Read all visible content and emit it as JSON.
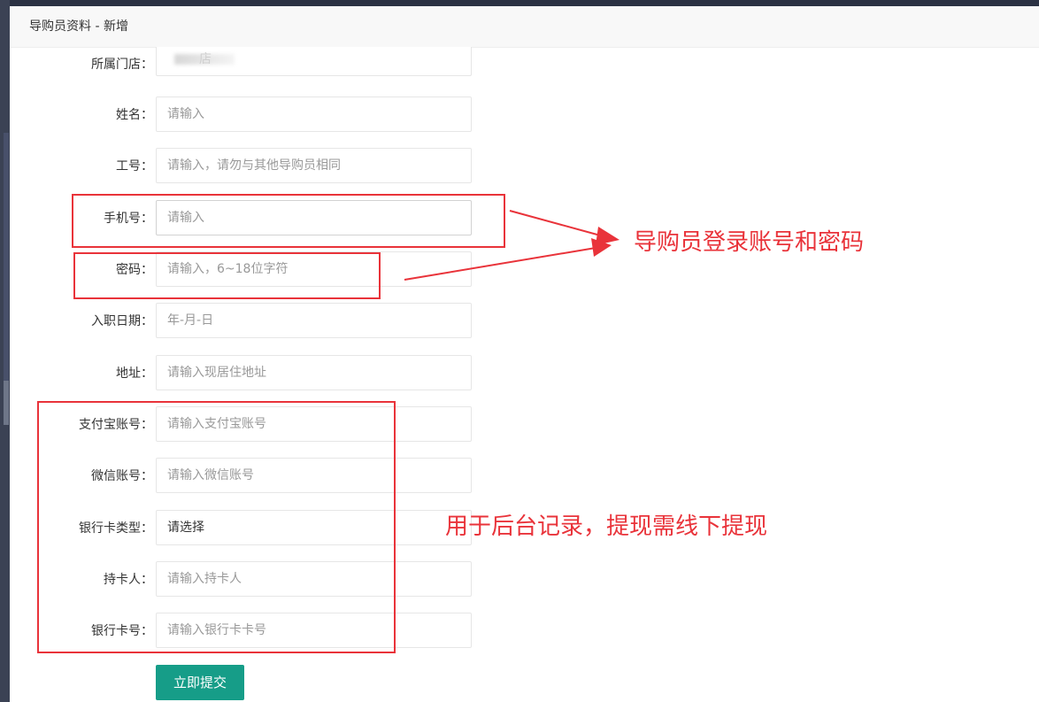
{
  "dialog": {
    "title": "导购员资料 - 新增"
  },
  "form": {
    "store": {
      "label": "所属门店：",
      "value_partial": "店"
    },
    "name": {
      "label": "姓名：",
      "placeholder": "请输入"
    },
    "employee_no": {
      "label": "工号：",
      "placeholder": "请输入，请勿与其他导购员相同"
    },
    "phone": {
      "label": "手机号：",
      "placeholder": "请输入"
    },
    "password": {
      "label": "密码：",
      "placeholder": "请输入，6~18位字符"
    },
    "hire_date": {
      "label": "入职日期：",
      "placeholder": "年-月-日"
    },
    "address": {
      "label": "地址：",
      "placeholder": "请输入现居住地址"
    },
    "alipay": {
      "label": "支付宝账号：",
      "placeholder": "请输入支付宝账号"
    },
    "wechat": {
      "label": "微信账号：",
      "placeholder": "请输入微信账号"
    },
    "bank_type": {
      "label": "银行卡类型：",
      "selected": "请选择"
    },
    "card_holder": {
      "label": "持卡人：",
      "placeholder": "请输入持卡人"
    },
    "card_no": {
      "label": "银行卡号：",
      "placeholder": "请输入银行卡卡号"
    },
    "submit_label": "立即提交"
  },
  "annotations": {
    "login_note": "导购员登录账号和密码",
    "record_note": "用于后台记录，提现需线下提现"
  },
  "colors": {
    "annotation_red": "#e9333a",
    "submit_green": "#169d88",
    "header_bg": "#f8f8f8",
    "top_bar": "#2b3243"
  }
}
